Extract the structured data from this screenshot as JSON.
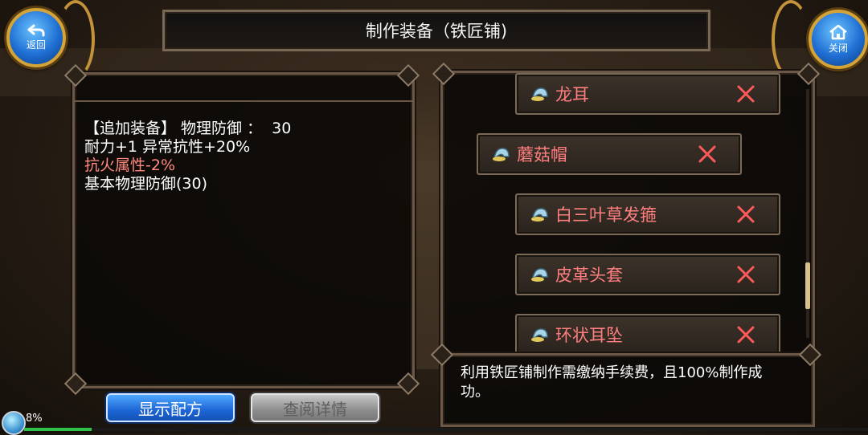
{
  "header": {
    "title": "制作装备（铁匠铺)",
    "back_label": "返回",
    "close_label": "关闭"
  },
  "detail": {
    "line1": "【追加装备】 物理防御 ：  30",
    "line2": "耐力+1 异常抗性+20%",
    "line3": "抗火属性-2%",
    "line4": "基本物理防御(30)"
  },
  "items": [
    {
      "name": "龙耳"
    },
    {
      "name": "蘑菇帽"
    },
    {
      "name": "白三叶草发箍"
    },
    {
      "name": "皮革头套"
    },
    {
      "name": "环状耳坠"
    }
  ],
  "info": {
    "text": "利用铁匠铺制作需缴纳手续费，且100%制作成功。"
  },
  "buttons": {
    "show_recipe": "显示配方",
    "view_details": "查阅详情"
  },
  "status": {
    "percent_label": "8%",
    "exp_fraction": 0.08
  },
  "colors": {
    "negative_stat": "#ff8a80",
    "item_name": "#ff7f7f",
    "accent_blue": "#1d66d6"
  }
}
